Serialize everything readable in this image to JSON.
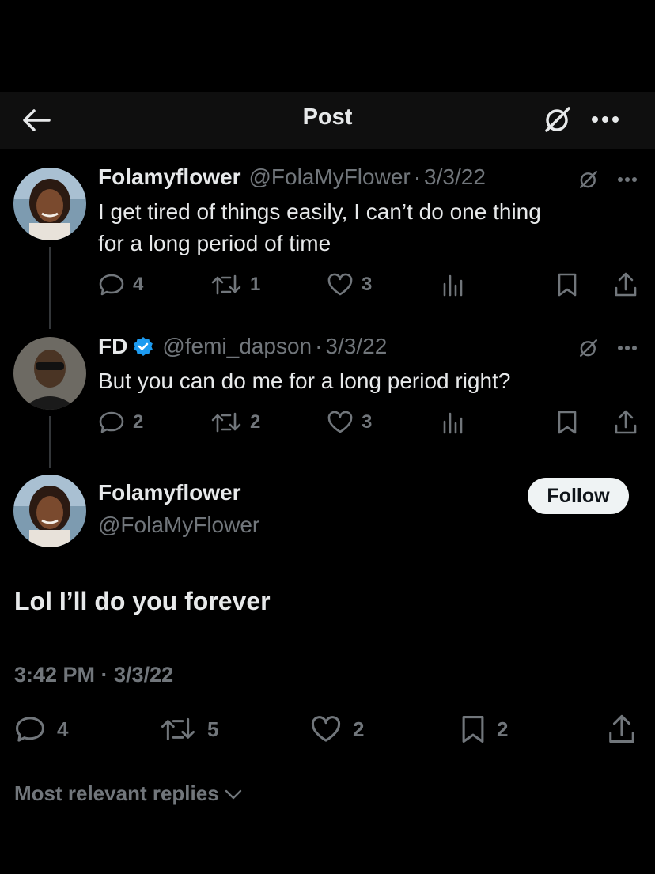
{
  "header": {
    "title": "Post"
  },
  "tweets": [
    {
      "name": "Folamyflower",
      "handle": "@FolaMyFlower",
      "date": "3/3/22",
      "line1": "I get tired of things easily, I can’t do one thing",
      "line2": "for a long period of time",
      "replies": "4",
      "reposts": "1",
      "likes": "3"
    },
    {
      "name": "FD",
      "handle": "@femi_dapson",
      "date": "3/3/22",
      "text": "But you can do me for a long period right?",
      "replies": "2",
      "reposts": "2",
      "likes": "3"
    }
  ],
  "focus": {
    "name": "Folamyflower",
    "handle": "@FolaMyFlower",
    "follow_label": "Follow",
    "text": "Lol I’ll do you forever",
    "timestamp": "3:42 PM · 3/3/22",
    "replies": "4",
    "reposts": "5",
    "likes": "2",
    "bookmarks": "2"
  },
  "sort": {
    "label": "Most relevant replies"
  },
  "colors": {
    "background": "#000000",
    "text": "#e7e9ea",
    "muted": "#71767b",
    "verified": "#1d9bf0"
  }
}
